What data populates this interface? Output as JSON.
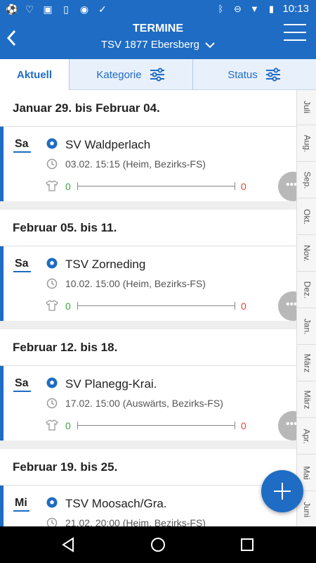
{
  "status_bar": {
    "time": "10:13",
    "left_icons": [
      "soccer-icon",
      "heart-icon",
      "image-icon",
      "phone-icon",
      "circle-icon",
      "check-icon"
    ],
    "right_icons": [
      "bluetooth-icon",
      "dnd-icon",
      "wifi-icon",
      "battery-icon"
    ]
  },
  "header": {
    "title": "TERMINE",
    "subtitle": "TSV 1877 Ebersberg"
  },
  "filters": {
    "tab_current": "Aktuell",
    "tab_category": "Kategorie",
    "tab_status": "Status"
  },
  "weeks": [
    {
      "heading": "Januar 29. bis Februar 04.",
      "match": {
        "day": "Sa",
        "team": "SV Waldperlach",
        "info": "03.02. 15:15 (Heim, Bezirks-FS)",
        "score_home": "0",
        "score_away": "0"
      }
    },
    {
      "heading": "Februar 05. bis 11.",
      "match": {
        "day": "Sa",
        "team": "TSV Zorneding",
        "info": "10.02. 15:00 (Heim, Bezirks-FS)",
        "score_home": "0",
        "score_away": "0"
      }
    },
    {
      "heading": "Februar 12. bis 18.",
      "match": {
        "day": "Sa",
        "team": "SV Planegg-Krai.",
        "info": "17.02. 15:00 (Auswärts, Bezirks-FS)",
        "score_home": "0",
        "score_away": "0"
      }
    },
    {
      "heading": "Februar 19. bis 25.",
      "match": {
        "day": "Mi",
        "team": "TSV Moosach/Gra.",
        "info": "21.02. 20:00 (Heim, Bezirks-FS)"
      }
    }
  ],
  "months": [
    "Juli",
    "Aug.",
    "Sep.",
    "Okt.",
    "Nov.",
    "Dez.",
    "Jan.",
    "März",
    "März",
    "Apr.",
    "Mai",
    "Juni"
  ],
  "colors": {
    "primary": "#1e6cc4",
    "score_win": "#3aa640",
    "score_loss": "#e0473a"
  }
}
